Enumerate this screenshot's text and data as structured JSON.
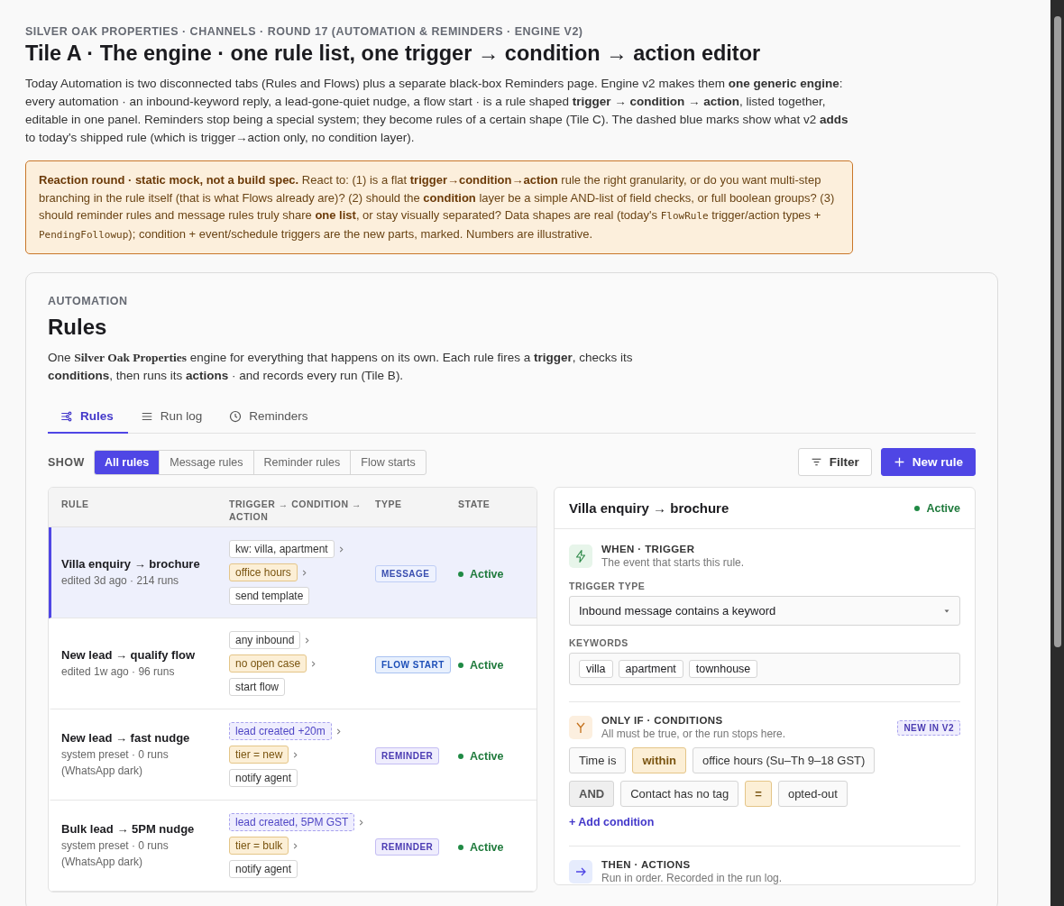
{
  "header": {
    "eyebrow": "SILVER OAK PROPERTIES · CHANNELS · ROUND 17 (AUTOMATION & REMINDERS · ENGINE V2)",
    "title": "Tile A · The engine · one rule list, one trigger → condition → action editor",
    "intro": "Today Automation is two disconnected tabs (Rules and Flows) plus a separate black-box Reminders page. Engine v2 makes them **one generic engine**: every automation · an inbound-keyword reply, a lead-gone-quiet nudge, a flow start · is a rule shaped **trigger → condition → action**, listed together, editable in one panel. Reminders stop being a special system; they become rules of a certain shape (Tile C). The dashed blue marks show what v2 **adds** to today's shipped rule (which is trigger→action only, no condition layer)."
  },
  "notice": [
    {
      "kind": "text",
      "text": "**Reaction round · static mock, not a build spec.** React to: (1) is a flat **trigger→condition→action** rule the right granularity, or do you want multi-step branching in the rule itself (that is what Flows already are)? (2) should the **condition** layer be a simple AND-list of field checks, or full boolean groups? (3) should reminder rules and message rules truly share **one list**, or stay visually separated? Data shapes are real (today's "
    },
    {
      "kind": "code",
      "text": "FlowRule"
    },
    {
      "kind": "text",
      "text": " trigger/action types + "
    },
    {
      "kind": "code",
      "text": "PendingFollowup"
    },
    {
      "kind": "text",
      "text": "); condition + event/schedule triggers are the new parts, marked. Numbers are illustrative."
    }
  ],
  "card": {
    "eyebrow": "AUTOMATION",
    "title": "Rules",
    "desc_before": "One ",
    "desc_brand": "Silver Oak Properties",
    "desc_after": " engine for everything that happens on its own. Each rule fires a **trigger**, checks its **conditions**, then runs its **actions** · and records every run (Tile B)."
  },
  "tabs": [
    {
      "label": "Rules",
      "selected": true
    },
    {
      "label": "Run log",
      "selected": false
    },
    {
      "label": "Reminders",
      "selected": false
    }
  ],
  "show": {
    "label": "SHOW",
    "options": [
      {
        "label": "All rules",
        "selected": true
      },
      {
        "label": "Message rules",
        "selected": false
      },
      {
        "label": "Reminder rules",
        "selected": false
      },
      {
        "label": "Flow starts",
        "selected": false
      }
    ]
  },
  "buttons": {
    "filter": "Filter",
    "new_rule": "New rule"
  },
  "table": {
    "columns": [
      "RULE",
      "TRIGGER → CONDITION → ACTION",
      "TYPE",
      "STATE"
    ],
    "rows": [
      {
        "name": "Villa enquiry → brochure",
        "meta": "edited 3d ago · 214 runs",
        "selected": true,
        "steps": [
          {
            "kind": "trigger",
            "text": "kw: villa, apartment"
          },
          {
            "kind": "condition",
            "text": "office hours"
          },
          {
            "kind": "action",
            "text": "send template"
          }
        ],
        "type": {
          "kind": "message",
          "label": "MESSAGE"
        },
        "state": "Active"
      },
      {
        "name": "New lead → qualify flow",
        "meta": "edited 1w ago · 96 runs",
        "selected": false,
        "steps": [
          {
            "kind": "trigger",
            "text": "any inbound"
          },
          {
            "kind": "condition",
            "text": "no open case"
          },
          {
            "kind": "action",
            "text": "start flow"
          }
        ],
        "type": {
          "kind": "flow",
          "label": "FLOW START"
        },
        "state": "Active"
      },
      {
        "name": "New lead → fast nudge",
        "meta": "system preset · 0 runs (WhatsApp dark)",
        "selected": false,
        "steps": [
          {
            "kind": "new",
            "text": "lead created +20m"
          },
          {
            "kind": "condition",
            "text": "tier = new"
          },
          {
            "kind": "action",
            "text": "notify agent"
          }
        ],
        "type": {
          "kind": "reminder",
          "label": "REMINDER"
        },
        "state": "Active"
      },
      {
        "name": "Bulk lead → 5PM nudge",
        "meta": "system preset · 0 runs (WhatsApp dark)",
        "selected": false,
        "steps": [
          {
            "kind": "new",
            "text": "lead created, 5PM GST"
          },
          {
            "kind": "condition",
            "text": "tier = bulk"
          },
          {
            "kind": "action",
            "text": "notify agent"
          }
        ],
        "type": {
          "kind": "reminder",
          "label": "REMINDER"
        },
        "state": "Active"
      }
    ]
  },
  "editor": {
    "title": "Villa enquiry → brochure",
    "state": "Active",
    "trigger": {
      "title": "WHEN · TRIGGER",
      "subtitle": "The event that starts this rule.",
      "type_label": "TRIGGER TYPE",
      "type_value": "Inbound message contains a keyword",
      "keywords_label": "KEYWORDS",
      "keywords": [
        "villa",
        "apartment",
        "townhouse"
      ]
    },
    "conditions": {
      "title": "ONLY IF · CONDITIONS",
      "subtitle": "All must be true, or the run stops here.",
      "badge": "NEW IN V2",
      "rows": [
        [
          {
            "kind": "field",
            "text": "Time is"
          },
          {
            "kind": "op",
            "text": "within"
          },
          {
            "kind": "field",
            "text": "office hours (Su–Th 9–18 GST)"
          }
        ],
        [
          {
            "kind": "join",
            "text": "AND"
          },
          {
            "kind": "field",
            "text": "Contact has no tag"
          },
          {
            "kind": "op",
            "text": "="
          },
          {
            "kind": "field",
            "text": "opted-out"
          }
        ]
      ],
      "add": "+ Add condition"
    },
    "actions": {
      "title": "THEN · ACTIONS",
      "subtitle": "Run in order. Recorded in the run log."
    }
  }
}
